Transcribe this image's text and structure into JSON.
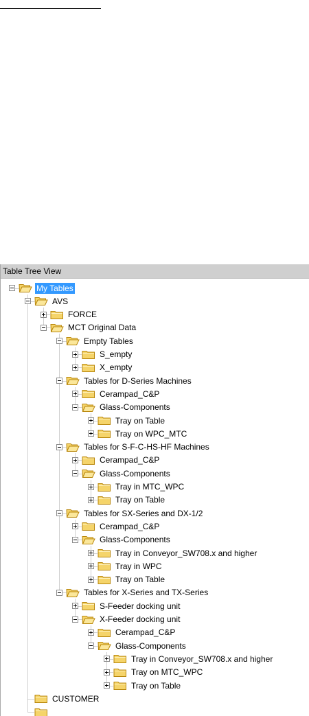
{
  "panel": {
    "title": "Table Tree View"
  },
  "colors": {
    "selection": "#3399ff",
    "folder": "#f5d46a",
    "folder_edge": "#b8860b"
  },
  "tree": [
    {
      "label": "My Tables",
      "depth": 0,
      "state": "expanded",
      "selected": true
    },
    {
      "label": "AVS",
      "depth": 1,
      "state": "expanded"
    },
    {
      "label": "FORCE",
      "depth": 2,
      "state": "collapsed"
    },
    {
      "label": "MCT Original Data",
      "depth": 2,
      "state": "expanded"
    },
    {
      "label": "Empty Tables",
      "depth": 3,
      "state": "expanded"
    },
    {
      "label": "S_empty",
      "depth": 4,
      "state": "collapsed"
    },
    {
      "label": "X_empty",
      "depth": 4,
      "state": "collapsed"
    },
    {
      "label": "Tables for D-Series Machines",
      "depth": 3,
      "state": "expanded"
    },
    {
      "label": "Cerampad_C&P",
      "depth": 4,
      "state": "collapsed"
    },
    {
      "label": "Glass-Components",
      "depth": 4,
      "state": "expanded"
    },
    {
      "label": "Tray on Table",
      "depth": 5,
      "state": "collapsed"
    },
    {
      "label": "Tray on WPC_MTC",
      "depth": 5,
      "state": "collapsed"
    },
    {
      "label": "Tables for S-F-C-HS-HF Machines",
      "depth": 3,
      "state": "expanded"
    },
    {
      "label": "Cerampad_C&P",
      "depth": 4,
      "state": "collapsed"
    },
    {
      "label": "Glass-Components",
      "depth": 4,
      "state": "expanded"
    },
    {
      "label": "Tray in MTC_WPC",
      "depth": 5,
      "state": "collapsed"
    },
    {
      "label": "Tray on Table",
      "depth": 5,
      "state": "collapsed"
    },
    {
      "label": "Tables for SX-Series and DX-1/2",
      "depth": 3,
      "state": "expanded"
    },
    {
      "label": "Cerampad_C&P",
      "depth": 4,
      "state": "collapsed"
    },
    {
      "label": "Glass-Components",
      "depth": 4,
      "state": "expanded"
    },
    {
      "label": "Tray in Conveyor_SW708.x and higher",
      "depth": 5,
      "state": "collapsed"
    },
    {
      "label": "Tray in WPC",
      "depth": 5,
      "state": "collapsed"
    },
    {
      "label": "Tray on Table",
      "depth": 5,
      "state": "collapsed"
    },
    {
      "label": "Tables for X-Series and TX-Series",
      "depth": 3,
      "state": "expanded"
    },
    {
      "label": "S-Feeder docking unit",
      "depth": 4,
      "state": "collapsed"
    },
    {
      "label": "X-Feeder docking unit",
      "depth": 4,
      "state": "expanded"
    },
    {
      "label": "Cerampad_C&P",
      "depth": 5,
      "state": "collapsed"
    },
    {
      "label": "Glass-Components",
      "depth": 5,
      "state": "expanded"
    },
    {
      "label": "Tray in Conveyor_SW708.x and higher",
      "depth": 6,
      "state": "collapsed"
    },
    {
      "label": "Tray on MTC_WPC",
      "depth": 6,
      "state": "collapsed"
    },
    {
      "label": "Tray on Table",
      "depth": 6,
      "state": "collapsed"
    },
    {
      "label": "CUSTOMER",
      "depth": 1,
      "state": "leaf"
    },
    {
      "label": "",
      "depth": 1,
      "state": "leaf"
    }
  ]
}
